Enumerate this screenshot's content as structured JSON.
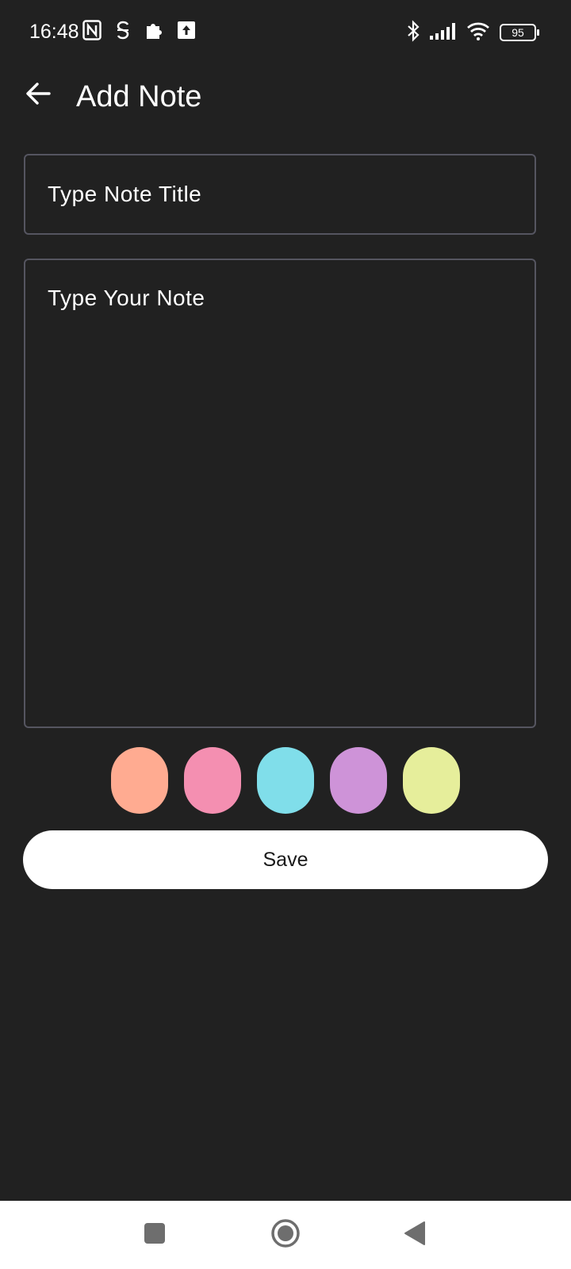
{
  "status_bar": {
    "time": "16:48",
    "left_icons": [
      "nfc-icon",
      "mobile-data-s-icon",
      "puzzle-icon",
      "upload-box-icon"
    ],
    "right_icons": [
      "bluetooth-icon",
      "cell-signal-icon",
      "wifi-icon"
    ],
    "battery_level": "95"
  },
  "app_bar": {
    "title": "Add Note",
    "back_icon": "arrow-left-icon"
  },
  "form": {
    "title_placeholder": "Type Note Title",
    "title_value": "",
    "note_placeholder": "Type Your Note",
    "note_value": ""
  },
  "colors": {
    "swatches": [
      "#FFAB91",
      "#F48FB1",
      "#80DEEA",
      "#CE93D8",
      "#E6EE9B"
    ]
  },
  "actions": {
    "save_label": "Save"
  },
  "nav_bar": {
    "items": [
      "recents-square-icon",
      "home-circle-icon",
      "back-triangle-icon"
    ]
  }
}
